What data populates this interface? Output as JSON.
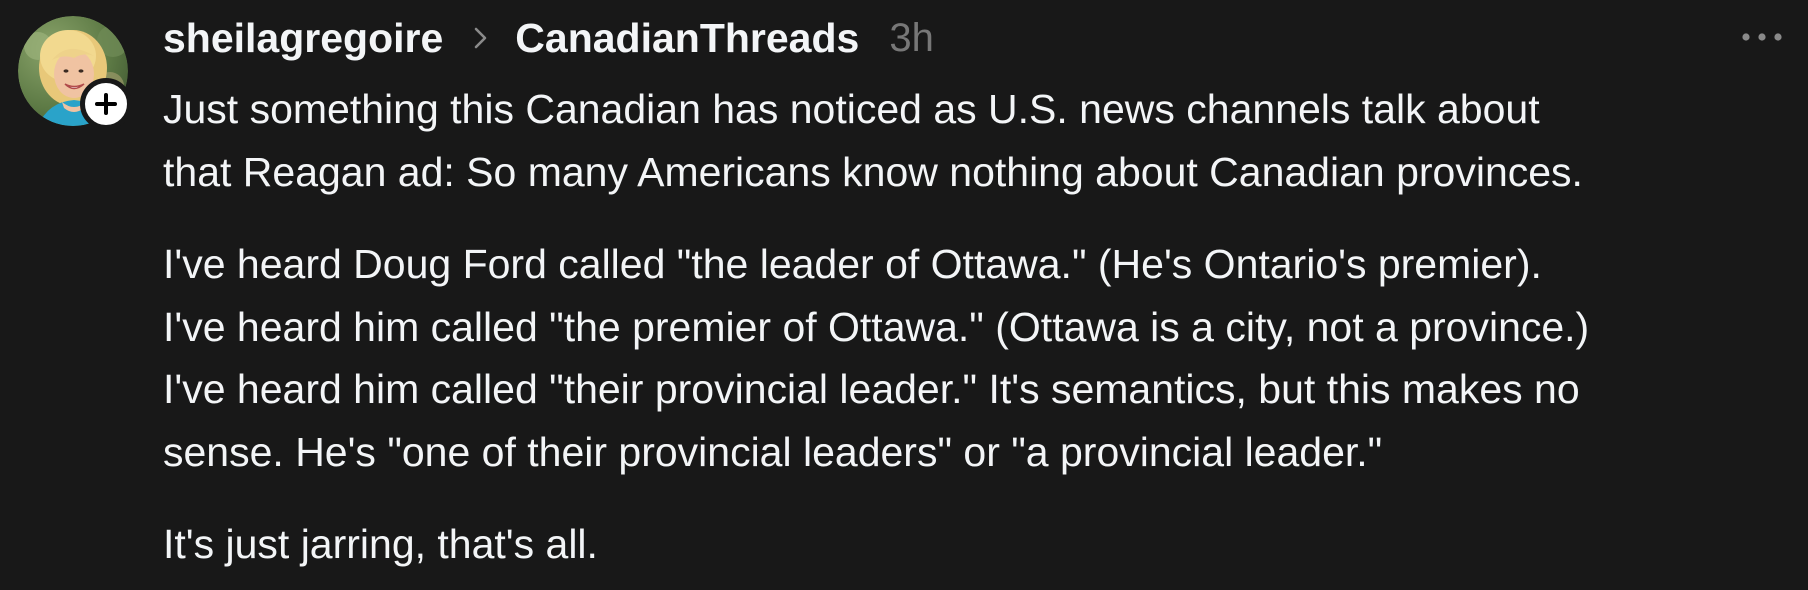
{
  "post": {
    "author": "sheilagregoire",
    "community": "CanadianThreads",
    "timestamp": "3h",
    "paragraphs": [
      "Just something this Canadian has noticed as U.S. news channels talk about\nthat Reagan ad: So many Americans know nothing about Canadian provinces.",
      "I've heard Doug Ford called \"the leader of Ottawa.\" (He's Ontario's premier).\nI've heard him called \"the premier of Ottawa.\" (Ottawa is a city, not a province.)\nI've heard him called \"their provincial leader.\" It's semantics, but this makes no\nsense. He's \"one of their provincial leaders\" or \"a provincial leader.\"",
      "It's just jarring, that's all."
    ]
  },
  "icons": {
    "follow": "plus-icon",
    "separator": "chevron-right-icon",
    "more": "more-horizontal-icon"
  },
  "colors": {
    "background": "#181818",
    "text": "#f3f5f7",
    "muted": "#777777"
  }
}
